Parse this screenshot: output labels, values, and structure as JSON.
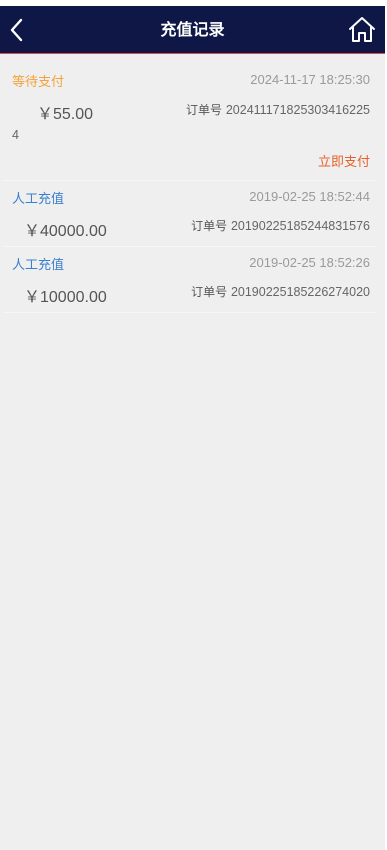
{
  "header": {
    "title": "充值记录"
  },
  "records": [
    {
      "status": "等待支付",
      "status_color": "#f5a23a",
      "time": "2024-11-17 18:25:30",
      "amount": "￥55.00",
      "order_label": "订单号",
      "order_no": "2024111718253034162254",
      "action": "立即支付"
    },
    {
      "status": "人工充值",
      "status_color": "#3a7fd0",
      "time": "2019-02-25 18:52:44",
      "amount": "￥40000.00",
      "order_label": "订单号",
      "order_no": "20190225185244831576"
    },
    {
      "status": "人工充值",
      "status_color": "#3a7fd0",
      "time": "2019-02-25 18:52:26",
      "amount": "￥10000.00",
      "order_label": "订单号",
      "order_no": "20190225185226274020"
    }
  ],
  "colors": {
    "header_bg": "#0e1746",
    "page_bg": "#efefef",
    "pay_action": "#e8612c"
  },
  "icons": {
    "back": "chevron-left-icon",
    "home": "home-icon"
  }
}
